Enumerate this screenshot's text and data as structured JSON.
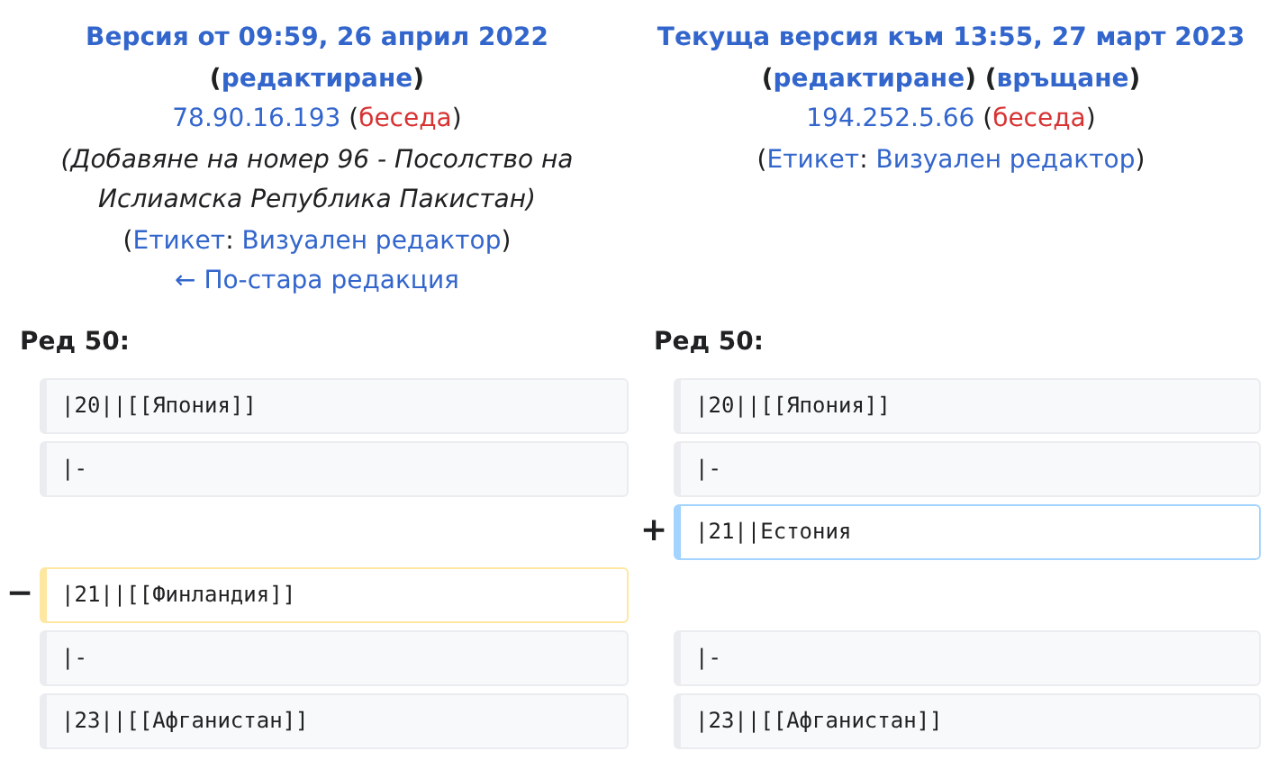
{
  "headers": [
    {
      "lines": [
        {
          "kind": "title",
          "segments": [
            {
              "text": "Версия от 09:59, 26 април 2022",
              "kind": "link"
            }
          ]
        },
        {
          "kind": "actions",
          "segments": [
            {
              "text": "(",
              "kind": "plain"
            },
            {
              "text": "редактиране",
              "kind": "link"
            },
            {
              "text": ")",
              "kind": "plain"
            }
          ]
        },
        {
          "kind": "user",
          "segments": [
            {
              "text": "78.90.16.193",
              "kind": "link"
            },
            {
              "text": " (",
              "kind": "plain"
            },
            {
              "text": "беседа",
              "kind": "redlink"
            },
            {
              "text": ")",
              "kind": "plain"
            }
          ]
        },
        {
          "kind": "summary",
          "text": "(Добавяне на номер 96 - Посолство на Ислиамска Република Пакистан)"
        },
        {
          "kind": "tag",
          "segments": [
            {
              "text": "(",
              "kind": "plain"
            },
            {
              "text": "Етикет",
              "kind": "link"
            },
            {
              "text": ": ",
              "kind": "plain"
            },
            {
              "text": "Визуален редактор",
              "kind": "link"
            },
            {
              "text": ")",
              "kind": "plain"
            }
          ]
        },
        {
          "kind": "nav",
          "segments": [
            {
              "text": "← По-стара редакция",
              "kind": "link"
            }
          ]
        }
      ]
    },
    {
      "lines": [
        {
          "kind": "title",
          "segments": [
            {
              "text": "Текуща версия към 13:55, 27 март 2023",
              "kind": "link"
            }
          ]
        },
        {
          "kind": "actions",
          "segments": [
            {
              "text": "(",
              "kind": "plain"
            },
            {
              "text": "редактиране",
              "kind": "link"
            },
            {
              "text": ") (",
              "kind": "plain"
            },
            {
              "text": "връщане",
              "kind": "link"
            },
            {
              "text": ")",
              "kind": "plain"
            }
          ]
        },
        {
          "kind": "user",
          "segments": [
            {
              "text": "194.252.5.66",
              "kind": "link"
            },
            {
              "text": " (",
              "kind": "plain"
            },
            {
              "text": "беседа",
              "kind": "redlink"
            },
            {
              "text": ")",
              "kind": "plain"
            }
          ]
        },
        {
          "kind": "tag",
          "segments": [
            {
              "text": "(",
              "kind": "plain"
            },
            {
              "text": "Етикет",
              "kind": "link"
            },
            {
              "text": ": ",
              "kind": "plain"
            },
            {
              "text": "Визуален редактор",
              "kind": "link"
            },
            {
              "text": ")",
              "kind": "plain"
            }
          ]
        }
      ]
    }
  ],
  "line_numbers": [
    "Ред 50:",
    "Ред 50:"
  ],
  "rows": [
    {
      "left": {
        "kind": "context",
        "text": "|20||[[Япония]]"
      },
      "right": {
        "kind": "context",
        "text": "|20||[[Япония]]"
      }
    },
    {
      "left": {
        "kind": "context",
        "text": "|-"
      },
      "right": {
        "kind": "context",
        "text": "|-"
      }
    },
    {
      "right": {
        "kind": "added",
        "marker": "+",
        "text": "|21||Естония"
      }
    },
    {
      "left": {
        "kind": "deleted",
        "marker": "−",
        "text": "|21||[[Финландия]]"
      }
    },
    {
      "left": {
        "kind": "context",
        "text": "|-"
      },
      "right": {
        "kind": "context",
        "text": "|-"
      }
    },
    {
      "left": {
        "kind": "context",
        "text": "|23||[[Афганистан]]"
      },
      "right": {
        "kind": "context",
        "text": "|23||[[Афганистан]]"
      }
    }
  ]
}
